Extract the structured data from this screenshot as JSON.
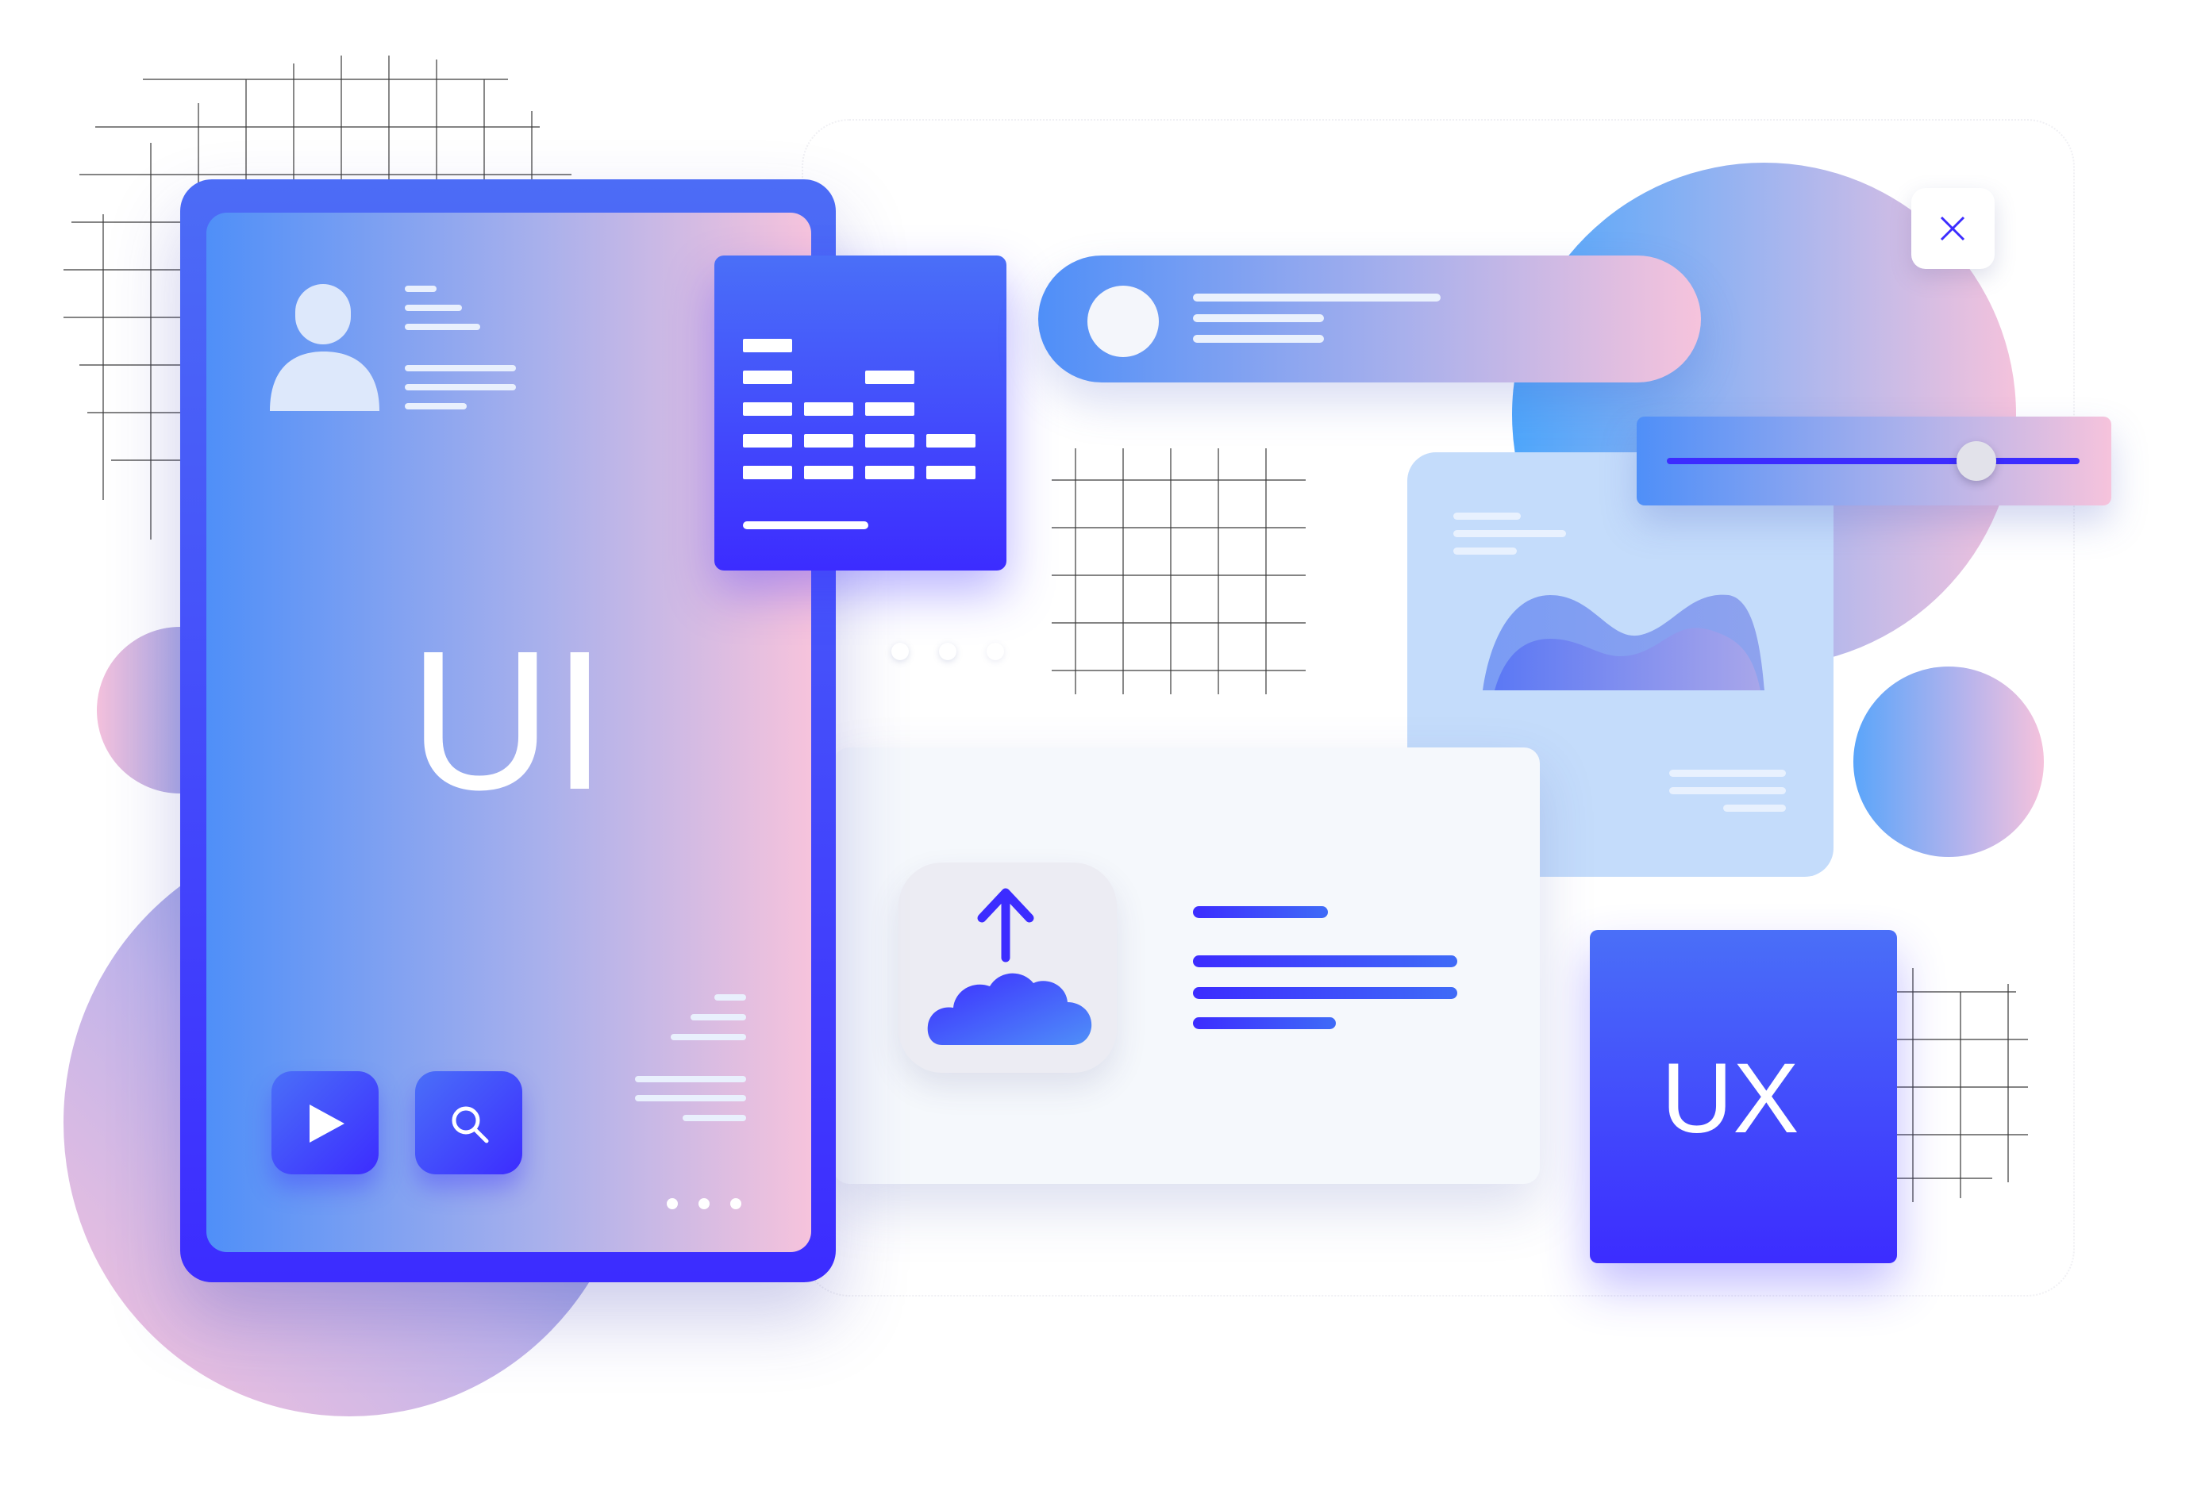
{
  "phone": {
    "title": "UI",
    "buttons": [
      {
        "icon": "play-icon"
      },
      {
        "icon": "search-icon"
      }
    ]
  },
  "ux_card": {
    "title": "UX"
  },
  "icons": {
    "close": "close-icon",
    "upload": "cloud-upload-icon",
    "avatar": "user-avatar-icon",
    "equalizer": "equalizer-icon",
    "area_chart": "area-chart-icon"
  },
  "slider": {
    "level": 0.75
  },
  "colors": {
    "deep_blue": "#3c2cff",
    "mid_blue": "#4f8ff8",
    "pink": "#f6c3dc",
    "light_blue": "#c4dcfb",
    "panel": "#f5f8fc"
  }
}
